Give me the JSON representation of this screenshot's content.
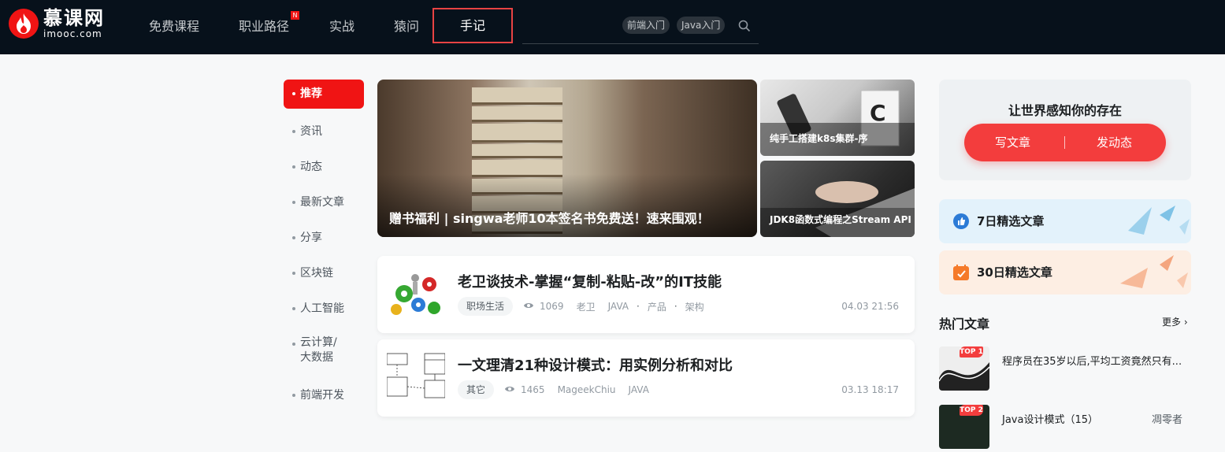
{
  "header": {
    "logo": {
      "cn": "慕课网",
      "en": "imooc.com"
    },
    "nav": [
      {
        "label": "免费课程"
      },
      {
        "label": "职业路径",
        "badge": "N"
      },
      {
        "label": "实战"
      },
      {
        "label": "猿问"
      },
      {
        "label": "手记"
      }
    ],
    "search_tags": [
      "前端入门",
      "Java入门"
    ],
    "icons": {
      "search": "search-icon"
    }
  },
  "sidebar": {
    "items": [
      "推荐",
      "资讯",
      "动态",
      "最新文章",
      "分享",
      "区块链",
      "人工智能",
      "云计算/大数据",
      "前端开发"
    ],
    "active_index": 0
  },
  "banners": {
    "main": {
      "title": "赠书福利 | singwa老师10本签名书免费送！速来围观！"
    },
    "side": [
      {
        "title": "纯手工搭建k8s集群-序"
      },
      {
        "title": "JDK8函数式编程之Stream API"
      }
    ]
  },
  "articles": [
    {
      "title": "老卫谈技术-掌握“复制-粘贴-改”的IT技能",
      "tag": "职场生活",
      "views": "1069",
      "author": "老卫",
      "categories": [
        "JAVA",
        "产品",
        "架构"
      ],
      "date": "04.03 21:56"
    },
    {
      "title": "一文理清21种设计模式：用实例分析和对比",
      "tag": "其它",
      "views": "1465",
      "author": "MageekChiu",
      "categories": [
        "JAVA"
      ],
      "date": "03.13 18:17"
    }
  ],
  "right": {
    "slogan": "让世界感知你的存在",
    "write_label": "写文章",
    "post_label": "发动态",
    "picks": [
      {
        "label": "7日精选文章",
        "color": "#e3f2fb"
      },
      {
        "label": "30日精选文章",
        "color": "#fdeee3"
      }
    ],
    "hot_title": "热门文章",
    "more_label": "更多",
    "hot": [
      {
        "rank": "TOP 1",
        "title": "程序员在35岁以后,平均工资竟然只有..."
      },
      {
        "rank": "TOP 2",
        "title": "Java设计模式（15）",
        "author": "凋零者"
      }
    ]
  },
  "colors": {
    "brand": "#f01414",
    "accent": "#f33d3d",
    "header_bg": "#07111b"
  }
}
